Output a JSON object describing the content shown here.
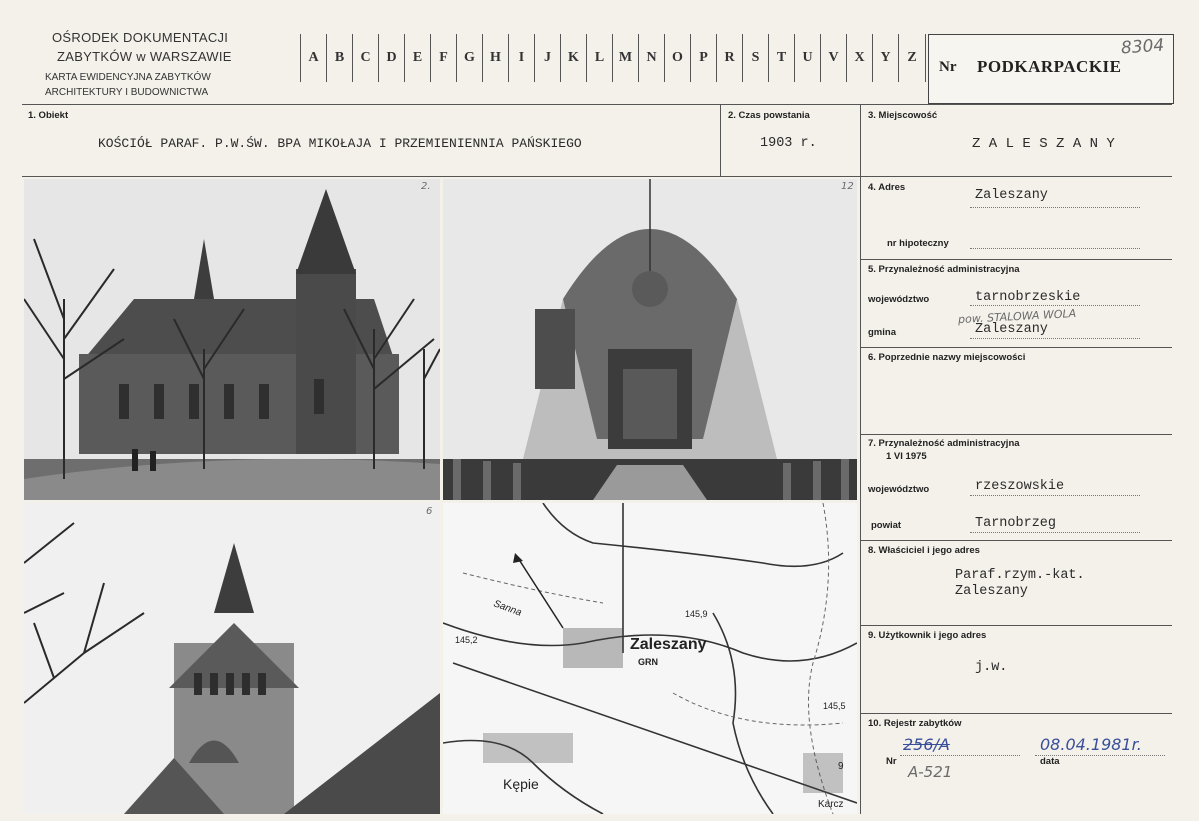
{
  "institution": {
    "line1": "OŚRODEK DOKUMENTACJI",
    "line2": "ZABYTKÓW w WARSZAWIE",
    "line3": "KARTA EWIDENCYJNA ZABYTKÓW",
    "line4": "ARCHITEKTURY I BUDOWNICTWA"
  },
  "alphabet": [
    "A",
    "B",
    "C",
    "D",
    "E",
    "F",
    "G",
    "H",
    "I",
    "J",
    "K",
    "L",
    "M",
    "N",
    "O",
    "P",
    "R",
    "S",
    "T",
    "U",
    "V",
    "X",
    "Y",
    "Z"
  ],
  "nr": {
    "label": "Nr",
    "value": "PODKARPACKIE",
    "stamp": "8304"
  },
  "fields": {
    "obiekt": {
      "label": "1. Obiekt",
      "value": "KOŚCIÓŁ PARAF. P.W.ŚW. BPA MIKOŁAJA I PRZEMIENIENNIA PAŃSKIEGO"
    },
    "czas": {
      "label": "2. Czas powstania",
      "value": "1903 r."
    },
    "miejscowosc": {
      "label": "3. Miejscowość",
      "value": "Z A L E S Z A N Y"
    },
    "adres": {
      "label": "4. Adres",
      "value": "Zaleszany",
      "hipoteczny_label": "nr hipoteczny"
    },
    "przynaleznosc": {
      "label": "5. Przynależność administracyjna",
      "woj_label": "województwo",
      "woj_value": "tarnobrzeskie",
      "pow_note": "pow. STALOWA WOLA",
      "gmina_label": "gmina",
      "gmina_value": "Zaleszany"
    },
    "poprzednie": {
      "label": "6. Poprzednie nazwy miejscowości"
    },
    "przynaleznosc1975": {
      "label": "7. Przynależność administracyjna",
      "date": "1 VI 1975",
      "woj_label": "województwo",
      "woj_value": "rzeszowskie",
      "powiat_label": "powiat",
      "powiat_value": "Tarnobrzeg"
    },
    "wlasciciel": {
      "label": "8. Właściciel i jego adres",
      "line1": "Paraf.rzym.-kat.",
      "line2": "Zaleszany"
    },
    "uzytkownik": {
      "label": "9. Użytkownik i jego adres",
      "value": "j.w."
    },
    "rejestr": {
      "label": "10. Rejestr zabytków",
      "nr_label": "Nr",
      "nr_value": "256/A",
      "nr_extra": "A-521",
      "data_label": "data",
      "data_value": "08.04.1981r."
    }
  },
  "photos": {
    "p1_num": "2.",
    "p2_num": "12",
    "p3_num": "6",
    "map": {
      "town": "Zaleszany",
      "grn": "GRN",
      "river": "Sanna",
      "elev1": "145,2",
      "elev2": "145,9",
      "elev3": "145,5",
      "village1": "Kępie",
      "village2": "Karcz",
      "num": "9"
    }
  }
}
